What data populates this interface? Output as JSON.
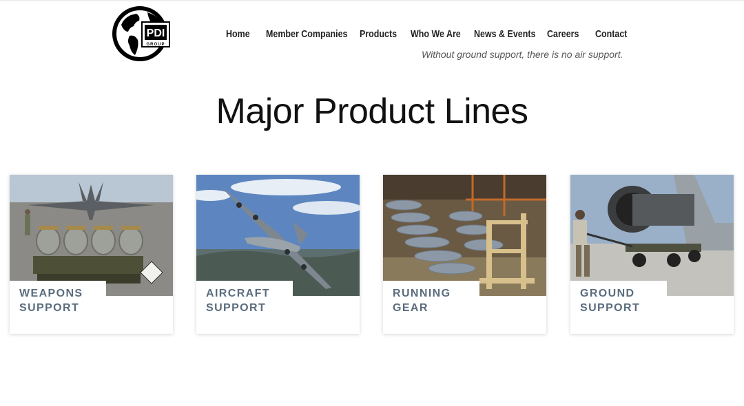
{
  "brand": {
    "logo_text": "PDI",
    "logo_subtext": "GROUP"
  },
  "nav": {
    "items": [
      {
        "label": "Home"
      },
      {
        "label": "Member Companies"
      },
      {
        "label": "Products"
      },
      {
        "label": "Who We Are"
      },
      {
        "label": "News & Events"
      },
      {
        "label": "Careers"
      },
      {
        "label": "Contact"
      }
    ]
  },
  "tagline": "Without ground support, there is no air support.",
  "page_title": "Major Product Lines",
  "products": [
    {
      "line1": "WEAPONS",
      "line2": "SUPPORT"
    },
    {
      "line1": "AIRCRAFT",
      "line2": "SUPPORT"
    },
    {
      "line1": "RUNNING",
      "line2": "GEAR"
    },
    {
      "line1": "GROUND",
      "line2": "SUPPORT"
    }
  ]
}
